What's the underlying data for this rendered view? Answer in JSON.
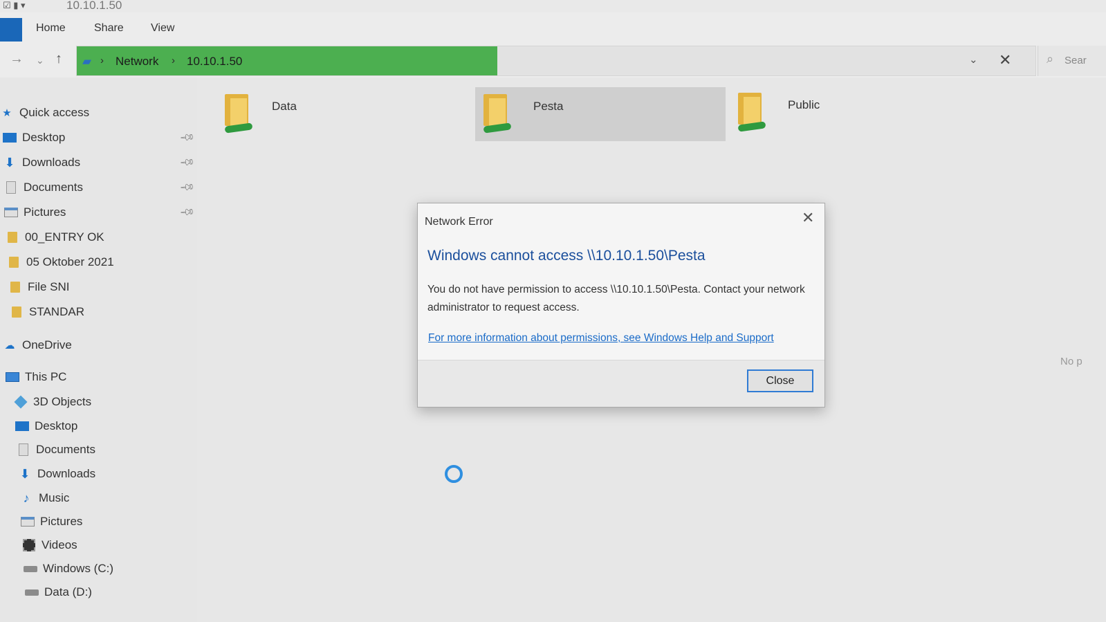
{
  "window": {
    "title": "10.10.1.50"
  },
  "ribbon": {
    "tabs": [
      "Home",
      "Share",
      "View"
    ]
  },
  "address": {
    "crumbs": [
      "Network",
      "10.10.1.50"
    ],
    "search_placeholder": "Sear"
  },
  "sidebar": {
    "quick_access": "Quick access",
    "quick_items": [
      {
        "label": "Desktop",
        "icon": "desktop-icon",
        "pinned": true
      },
      {
        "label": "Downloads",
        "icon": "download-icon",
        "pinned": true
      },
      {
        "label": "Documents",
        "icon": "documents-icon",
        "pinned": true
      },
      {
        "label": "Pictures",
        "icon": "pictures-icon",
        "pinned": true
      },
      {
        "label": "00_ENTRY OK",
        "icon": "folder-icon",
        "pinned": false
      },
      {
        "label": "05 Oktober 2021",
        "icon": "folder-icon",
        "pinned": false
      },
      {
        "label": "File SNI",
        "icon": "folder-icon",
        "pinned": false
      },
      {
        "label": "STANDAR",
        "icon": "folder-icon",
        "pinned": false
      }
    ],
    "onedrive": "OneDrive",
    "this_pc": "This PC",
    "pc_items": [
      {
        "label": "3D Objects",
        "icon": "3d-objects-icon"
      },
      {
        "label": "Desktop",
        "icon": "desktop-icon"
      },
      {
        "label": "Documents",
        "icon": "documents-icon"
      },
      {
        "label": "Downloads",
        "icon": "download-icon"
      },
      {
        "label": "Music",
        "icon": "music-icon"
      },
      {
        "label": "Pictures",
        "icon": "pictures-icon"
      },
      {
        "label": "Videos",
        "icon": "videos-icon"
      },
      {
        "label": "Windows (C:)",
        "icon": "drive-icon"
      },
      {
        "label": "Data (D:)",
        "icon": "drive-icon"
      }
    ]
  },
  "content": {
    "shares": [
      {
        "name": "Data",
        "selected": false
      },
      {
        "name": "Pesta",
        "selected": true
      },
      {
        "name": "Public",
        "selected": false
      }
    ],
    "right_hint": "No p"
  },
  "dialog": {
    "title": "Network Error",
    "heading": "Windows cannot access \\\\10.10.1.50\\Pesta",
    "message": "You do not have permission to access \\\\10.10.1.50\\Pesta. Contact your network administrator to request access.",
    "link": "For more information about permissions, see Windows Help and Support",
    "close_label": "Close"
  },
  "colors": {
    "address_highlight": "#4caf50",
    "accent": "#1a67b8",
    "link": "#1a6bc8",
    "dialog_heading": "#1b4f9c"
  }
}
